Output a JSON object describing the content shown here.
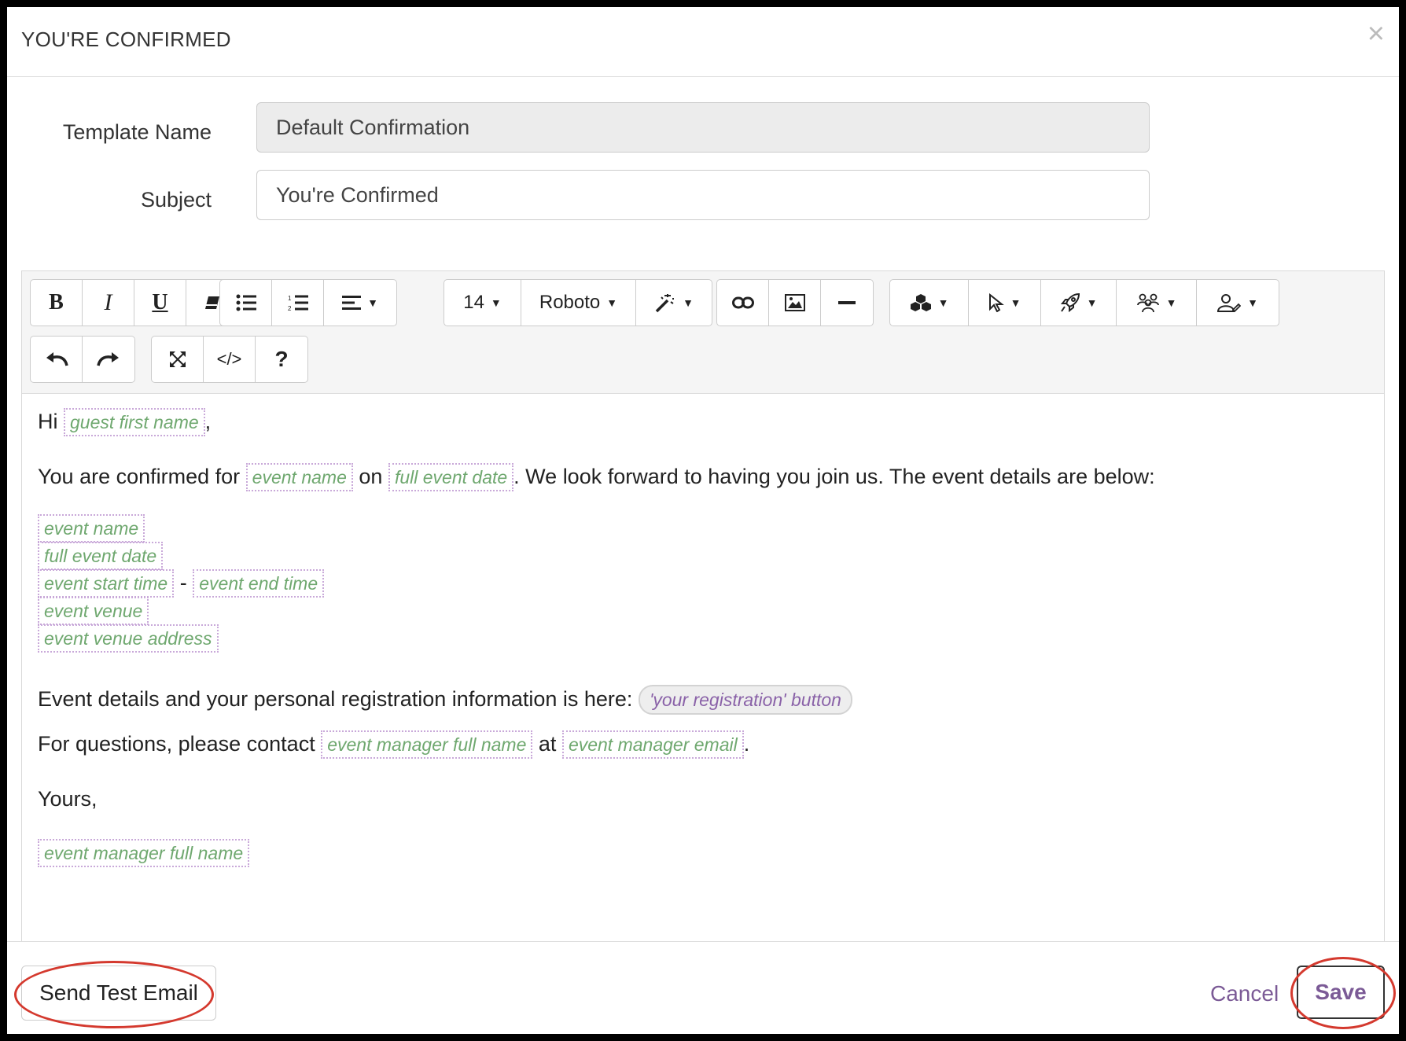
{
  "modal": {
    "title": "YOU'RE CONFIRMED",
    "close_symbol": "×"
  },
  "form": {
    "template_name_label": "Template Name",
    "template_name_value": "Default Confirmation",
    "subject_label": "Subject",
    "subject_value": "You're Confirmed"
  },
  "toolbar": {
    "bold": "B",
    "italic": "I",
    "underline": "U",
    "font_size": "14",
    "font_family": "Roboto",
    "help": "?",
    "code": "</>",
    "icons": [
      "bold-icon",
      "italic-icon",
      "underline-icon",
      "eraser-icon",
      "bullet-list-icon",
      "numbered-list-icon",
      "align-icon",
      "magic-wand-icon",
      "link-icon",
      "image-icon",
      "horizontal-rule-icon",
      "blocks-icon",
      "cursor-icon",
      "rocket-icon",
      "people-icon",
      "person-icon",
      "undo-icon",
      "redo-icon",
      "fullscreen-icon",
      "code-icon",
      "help-icon"
    ]
  },
  "body": {
    "hi": "Hi",
    "guest_first_name": "guest first name",
    "comma": ",",
    "confirmed_for": "You are confirmed for",
    "event_name": "event name",
    "on": "on",
    "full_event_date": "full event date",
    "look_forward": ". We look forward to having you join us. The event details are below:",
    "event_start_time": "event start time",
    "dash": "-",
    "event_end_time": "event end time",
    "event_venue": "event venue",
    "event_venue_address": "event venue address",
    "details_text": "Event details and your personal registration information is here:",
    "registration_button": "'your registration' button",
    "questions_text": "For questions, please contact",
    "event_manager_full_name": "event manager full name",
    "at": "at",
    "event_manager_email": "event manager email",
    "period": ".",
    "yours": "Yours,"
  },
  "footer": {
    "send_test_email": "Send Test Email",
    "cancel": "Cancel",
    "save": "Save"
  },
  "colors": {
    "accent": "#7b5a96",
    "tag_text": "#6fa86f",
    "tag_border": "#c9a9d9",
    "highlight_ring": "#d4392e"
  }
}
